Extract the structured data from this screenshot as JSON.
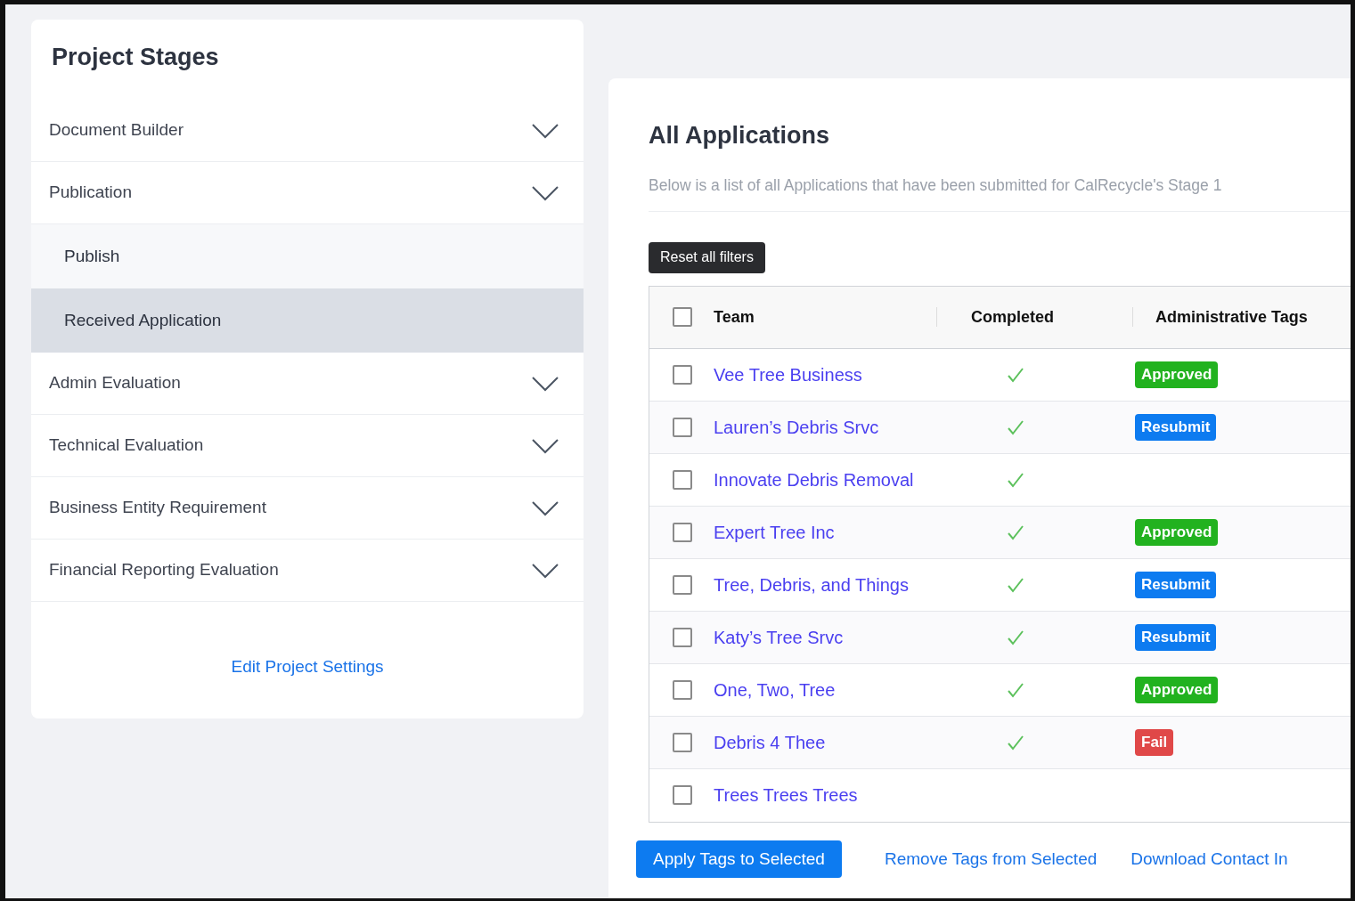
{
  "sidebar": {
    "title": "Project Stages",
    "stages": [
      {
        "label": "Document Builder"
      },
      {
        "label": "Publication",
        "children": [
          {
            "label": "Publish",
            "selected": false
          },
          {
            "label": "Received Application",
            "selected": true
          }
        ]
      },
      {
        "label": "Admin Evaluation"
      },
      {
        "label": "Technical Evaluation"
      },
      {
        "label": "Business Entity Requirement"
      },
      {
        "label": "Financial Reporting Evaluation"
      }
    ],
    "settings_link": "Edit Project Settings"
  },
  "main": {
    "title": "All Applications",
    "description": "Below is a list of all Applications that have been submitted for CalRecycle's Stage 1",
    "reset_button": "Reset all filters",
    "table": {
      "select_all": {
        "checked": false
      },
      "columns": [
        "Team",
        "Completed",
        "Administrative Tags"
      ],
      "rows": [
        {
          "team": "Vee Tree Business",
          "checked": false,
          "completed": true,
          "tag": {
            "label": "Approved",
            "kind": "approved"
          }
        },
        {
          "team": "Lauren’s Debris Srvc",
          "checked": false,
          "completed": true,
          "tag": {
            "label": "Resubmit",
            "kind": "resubmit"
          }
        },
        {
          "team": "Innovate Debris Removal",
          "checked": false,
          "completed": true
        },
        {
          "team": "Expert Tree Inc",
          "checked": false,
          "completed": true,
          "tag": {
            "label": "Approved",
            "kind": "approved"
          }
        },
        {
          "team": "Tree, Debris, and Things",
          "checked": false,
          "completed": true,
          "tag": {
            "label": "Resubmit",
            "kind": "resubmit"
          }
        },
        {
          "team": "Katy’s Tree Srvc",
          "checked": false,
          "completed": true,
          "tag": {
            "label": "Resubmit",
            "kind": "resubmit"
          }
        },
        {
          "team": "One, Two, Tree",
          "checked": false,
          "completed": true,
          "tag": {
            "label": "Approved",
            "kind": "approved"
          }
        },
        {
          "team": "Debris 4 Thee",
          "checked": false,
          "completed": true,
          "tag": {
            "label": "Fail",
            "kind": "fail"
          }
        },
        {
          "team": "Trees Trees Trees",
          "checked": false,
          "completed": false
        }
      ]
    },
    "actions": {
      "primary": "Apply Tags to Selected",
      "links": [
        "Remove Tags from Selected",
        "Download Contact In"
      ]
    }
  }
}
